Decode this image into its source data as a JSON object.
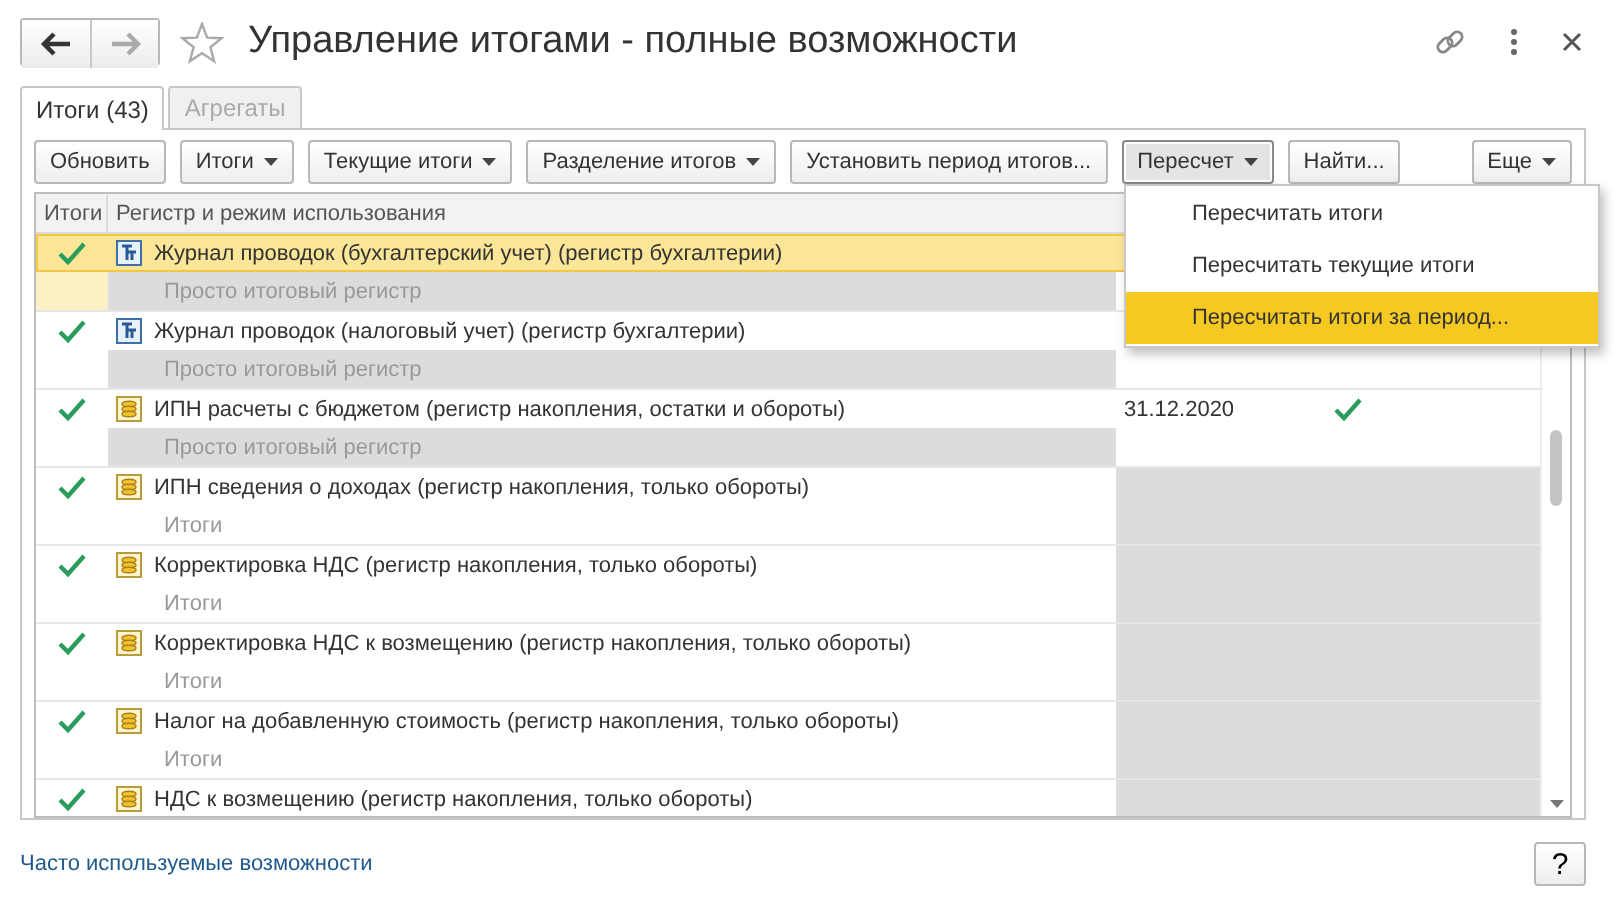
{
  "window": {
    "title": "Управление итогами - полные возможности"
  },
  "tabs": [
    {
      "label": "Итоги (43)",
      "selected": true
    },
    {
      "label": "Агрегаты",
      "selected": false
    }
  ],
  "toolbar": [
    {
      "label": "Обновить",
      "dropdown": false,
      "pressed": false
    },
    {
      "label": "Итоги",
      "dropdown": true,
      "pressed": false
    },
    {
      "label": "Текущие итоги",
      "dropdown": true,
      "pressed": false
    },
    {
      "label": "Разделение итогов",
      "dropdown": true,
      "pressed": false
    },
    {
      "label": "Установить период итогов...",
      "dropdown": false,
      "pressed": false
    },
    {
      "label": "Пересчет",
      "dropdown": true,
      "pressed": true
    },
    {
      "label": "Найти...",
      "dropdown": false,
      "pressed": false
    }
  ],
  "more_button": {
    "label": "Еще",
    "dropdown": true
  },
  "table": {
    "columns": [
      "Итоги",
      "Регистр и режим использования"
    ],
    "rows": [
      {
        "checked": true,
        "kind": "accounting",
        "name": "Журнал проводок (бухгалтерский учет) (регистр бухгалтерии)",
        "mode": "Просто итоговый регистр",
        "selected": true,
        "mode_shaded": true,
        "period_disabled": false
      },
      {
        "checked": true,
        "kind": "accounting",
        "name": "Журнал проводок (налоговый учет) (регистр бухгалтерии)",
        "mode": "Просто итоговый регистр",
        "selected": false,
        "mode_shaded": true,
        "period_disabled": false
      },
      {
        "checked": true,
        "kind": "accumulation",
        "name": "ИПН расчеты с бюджетом (регистр накопления, остатки и обороты)",
        "mode": "Просто итоговый регистр",
        "selected": false,
        "mode_shaded": true,
        "period_disabled": false,
        "date": "31.12.2020",
        "date_checked": true
      },
      {
        "checked": true,
        "kind": "accumulation",
        "name": "ИПН сведения о доходах (регистр накопления, только обороты)",
        "mode": "Итоги",
        "selected": false,
        "mode_shaded": false,
        "period_disabled": true
      },
      {
        "checked": true,
        "kind": "accumulation",
        "name": "Корректировка НДС (регистр накопления, только обороты)",
        "mode": "Итоги",
        "selected": false,
        "mode_shaded": false,
        "period_disabled": true
      },
      {
        "checked": true,
        "kind": "accumulation",
        "name": "Корректировка НДС к возмещению (регистр накопления, только обороты)",
        "mode": "Итоги",
        "selected": false,
        "mode_shaded": false,
        "period_disabled": true
      },
      {
        "checked": true,
        "kind": "accumulation",
        "name": "Налог на добавленную стоимость (регистр накопления, только обороты)",
        "mode": "Итоги",
        "selected": false,
        "mode_shaded": false,
        "period_disabled": true
      },
      {
        "checked": true,
        "kind": "accumulation",
        "name": "НДС к возмещению (регистр накопления, только обороты)",
        "selected": false,
        "mode_shaded": false,
        "period_disabled": true
      }
    ]
  },
  "menu": {
    "items": [
      {
        "label": "Пересчитать итоги",
        "selected": false
      },
      {
        "label": "Пересчитать текущие итоги",
        "selected": false
      },
      {
        "label": "Пересчитать итоги за период...",
        "selected": true
      }
    ]
  },
  "footer": {
    "link": "Часто используемые возможности",
    "help": "?"
  }
}
